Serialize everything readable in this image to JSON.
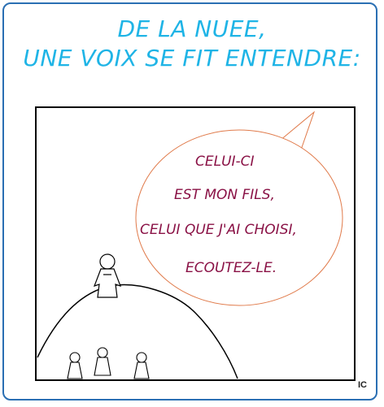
{
  "caption": {
    "line1": "DE LA NUEE,",
    "line2": "UNE VOIX SE FIT ENTENDRE:"
  },
  "speech_bubble": {
    "lines": [
      "CELUI-CI",
      "EST MON FILS,",
      "CELUI QUE J'AI CHOISI,",
      "ECOUTEZ-LE."
    ]
  },
  "signature": "IC",
  "colors": {
    "caption": "#1fb4e6",
    "frame_border": "#2a6fb3",
    "speech_text": "#8a1246",
    "bubble_outline": "#e07a4a",
    "ink": "#000000"
  }
}
